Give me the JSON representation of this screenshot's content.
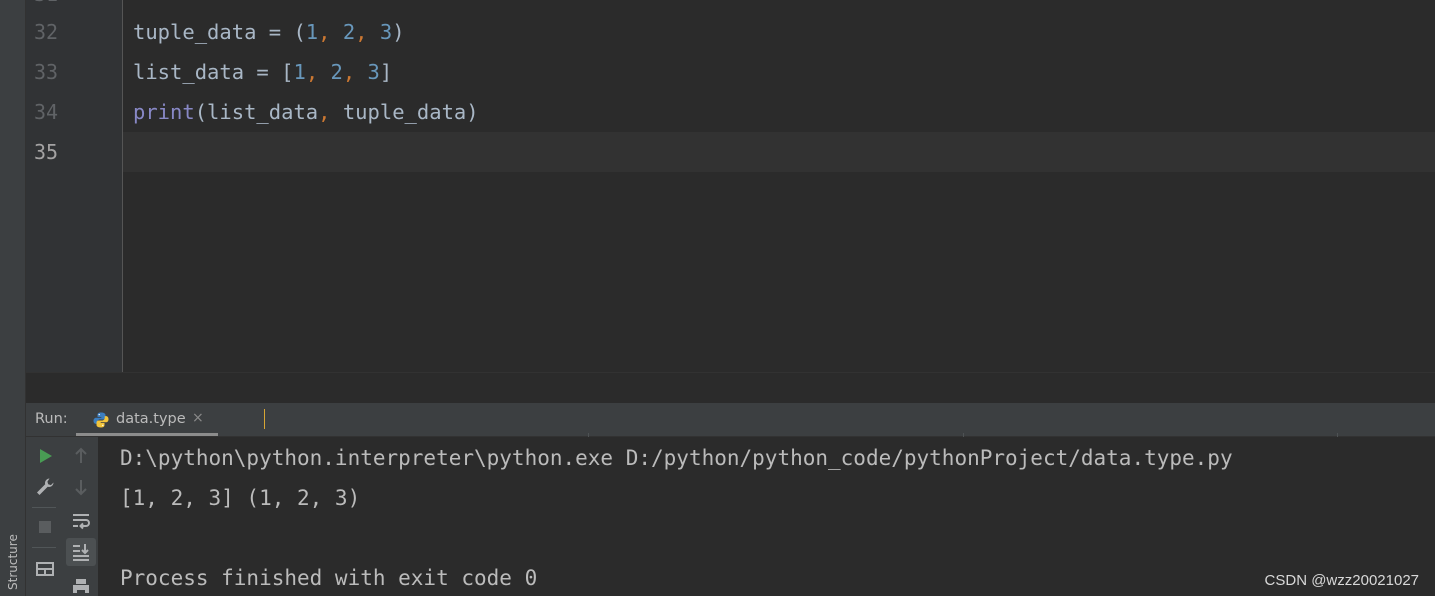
{
  "left_strip": {
    "structure_label": "Structure"
  },
  "editor": {
    "lines": [
      {
        "number": "32"
      },
      {
        "number": "33"
      },
      {
        "number": "34"
      },
      {
        "number": "35"
      }
    ],
    "code": {
      "line32": {
        "var": "tuple_data",
        "assign": " = (",
        "n1": "1",
        "n2": "2",
        "n3": "3",
        "close": ")"
      },
      "line33": {
        "var": "list_data",
        "assign": " = [",
        "n1": "1",
        "n2": "2",
        "n3": "3",
        "close": "]"
      },
      "line34": {
        "func": "print",
        "args_open": "(list_data",
        "arg2": " tuple_data)"
      }
    },
    "comma": ",",
    "colors": {
      "keyword_builtin": "#8888c6",
      "number": "#6897bb",
      "punctuation": "#cc7832",
      "text": "#a9b7c6"
    }
  },
  "run_panel": {
    "label": "Run:",
    "tab_name": "data.type",
    "tab_close": "×",
    "toolbar_icons": [
      "run-icon",
      "wrench-icon",
      "stop-icon",
      "layout-icon",
      "arrow-up-icon",
      "arrow-down-icon",
      "soft-wrap-icon",
      "scroll-to-end-icon",
      "print-icon"
    ]
  },
  "console": {
    "lines": [
      "D:\\python\\python.interpreter\\python.exe D:/python/python_code/pythonProject/data.type.py",
      "[1, 2, 3] (1, 2, 3)",
      "",
      "Process finished with exit code 0"
    ]
  },
  "watermark": "CSDN @wzz20021027"
}
